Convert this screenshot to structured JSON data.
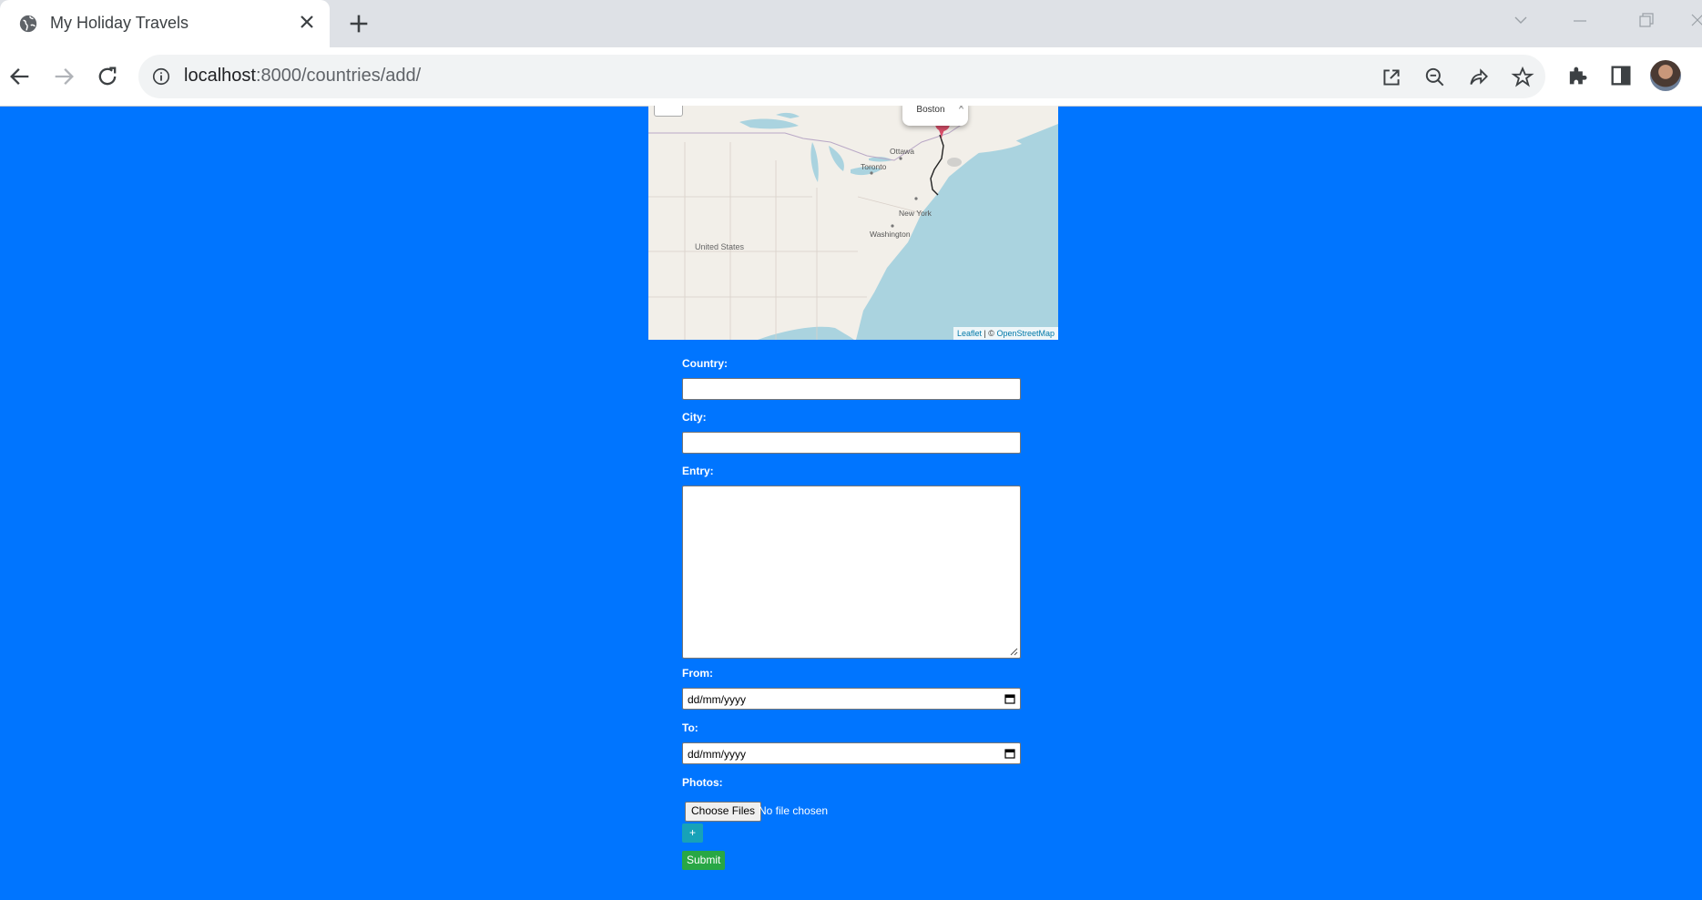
{
  "browser": {
    "tab_title": "My Holiday Travels",
    "url_host": "localhost",
    "url_path": ":8000/countries/add/"
  },
  "map": {
    "popup_text": "Boston",
    "popup_close": "×",
    "labels": {
      "ottawa": "Ottawa",
      "toronto": "Toronto",
      "new_york": "New York",
      "washington": "Washington",
      "united_states": "United States"
    },
    "attribution_leaflet": "Leaflet",
    "attribution_sep": " | © ",
    "attribution_osm": "OpenStreetMap"
  },
  "form": {
    "country_label": "Country:",
    "country_value": "",
    "city_label": "City:",
    "city_value": "",
    "entry_label": "Entry:",
    "entry_value": "",
    "from_label": "From:",
    "from_placeholder": "dd/mm/yyyy",
    "to_label": "To:",
    "to_placeholder": "dd/mm/yyyy",
    "photos_label": "Photos:",
    "choose_files_label": "Choose Files",
    "file_status": "No file chosen",
    "add_button_label": "+",
    "submit_label": "Submit"
  },
  "colors": {
    "page_bg": "#0075ff",
    "add_button": "#17a2b8",
    "submit_button": "#28a745",
    "marker": "#d94f6a"
  }
}
